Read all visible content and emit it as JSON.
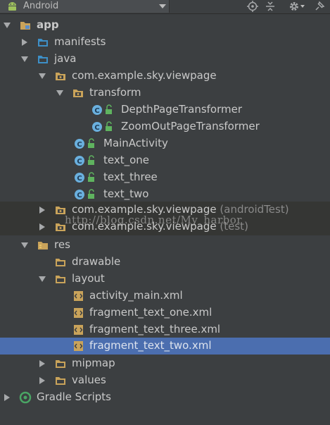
{
  "toolbar": {
    "view_label": "Android",
    "icons": [
      "android-icon",
      "target-icon",
      "collapse-icon",
      "gear-icon",
      "pin-icon"
    ]
  },
  "tree": {
    "app": "app",
    "manifests": "manifests",
    "java": "java",
    "pkg_main": "com.example.sky.viewpage",
    "transform": "transform",
    "depth": "DepthPageTransformer",
    "zoom": "ZoomOutPageTransformer",
    "main_activity": "MainActivity",
    "text_one": "text_one",
    "text_three": "text_three",
    "text_two": "text_two",
    "pkg_android_test": "com.example.sky.viewpage",
    "pkg_android_test_suffix": "(androidTest)",
    "pkg_test": "com.example.sky.viewpage",
    "pkg_test_suffix": "(test)",
    "res": "res",
    "drawable": "drawable",
    "layout": "layout",
    "activity_main": "activity_main.xml",
    "frag_one": "fragment_text_one.xml",
    "frag_three": "fragment_text_three.xml",
    "frag_two": "fragment_text_two.xml",
    "mipmap": "mipmap",
    "values": "values",
    "gradle": "Gradle Scripts"
  },
  "watermark": "http://blog.csdn.net/My_harbor",
  "colors": {
    "background": "#3c3f41",
    "selection": "#4b6eaf",
    "folder": "#c9a35a",
    "class_badge": "#6ab0de"
  }
}
